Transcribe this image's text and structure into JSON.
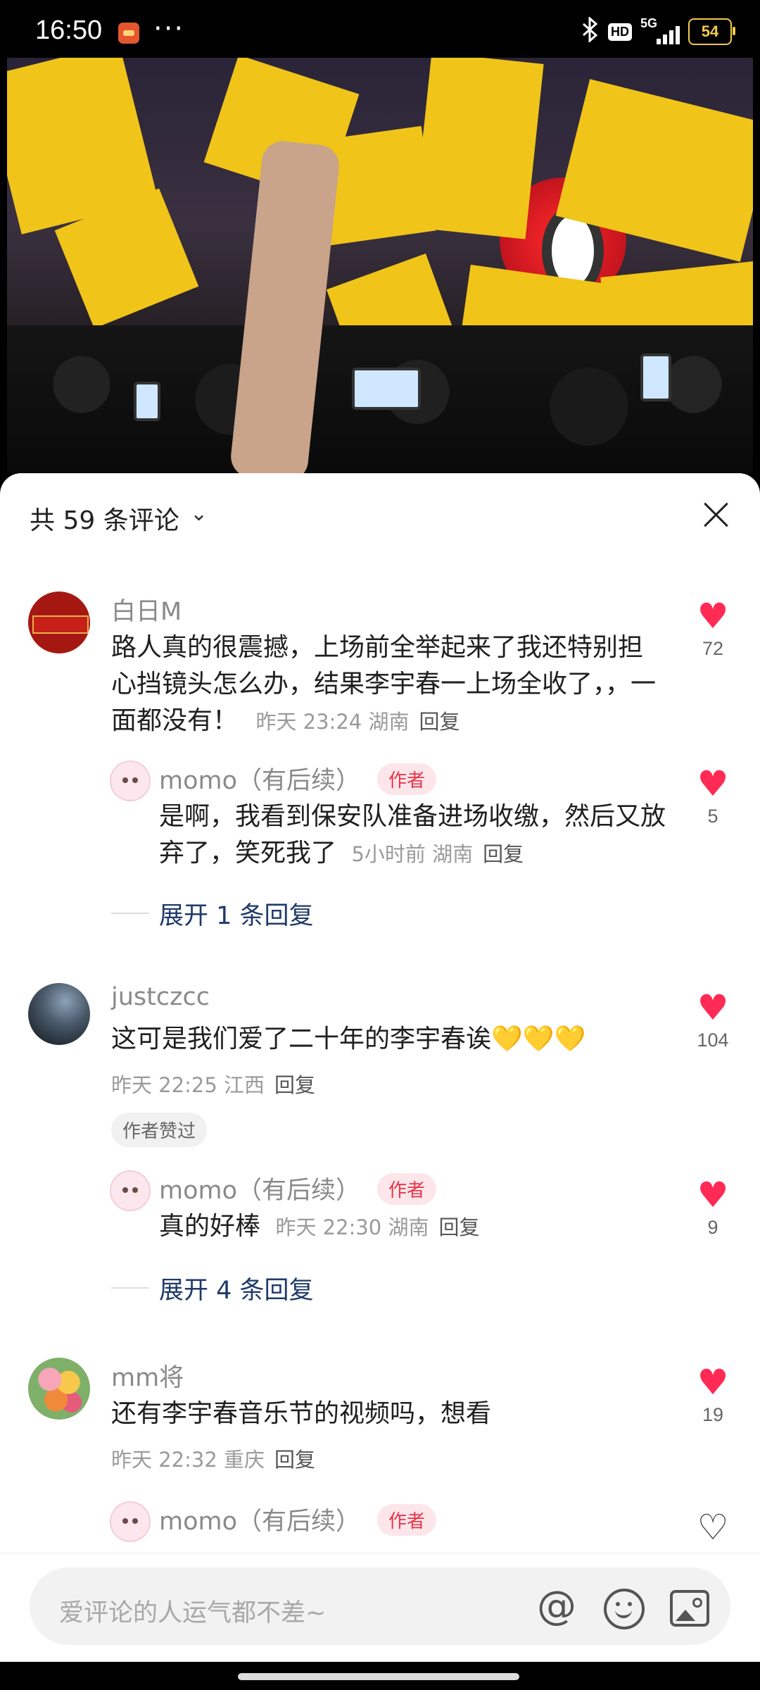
{
  "status_bar": {
    "time": "16:50",
    "dots": "···",
    "hd": "HD",
    "network": "5G",
    "battery": "54"
  },
  "icons": {
    "bluetooth": "bluetooth-icon",
    "close": "close-icon",
    "heart": "heart-icon",
    "at": "at-icon",
    "emoji": "emoji-icon",
    "image": "image-icon"
  },
  "header": {
    "count_label": "共 59 条评论",
    "chevron": "⌄"
  },
  "comments": [
    {
      "user": "白日M",
      "text": "路人真的很震撼，上场前全举起来了我还特别担心挡镜头怎么办，结果李宇春一上场全收了，，一面都没有！",
      "meta": "昨天 23:24 湖南",
      "reply_label": "回复",
      "likes": "72",
      "replies": [
        {
          "user": "momo（有后续）",
          "tag": "作者",
          "text": "是啊，我看到保安队准备进场收缴，然后又放弃了，笑死我了",
          "meta": "5小时前 湖南",
          "reply_label": "回复",
          "likes": "5"
        }
      ],
      "expand": "展开 1 条回复"
    },
    {
      "user": "justczcc",
      "text": "这可是我们爱了二十年的李宇春诶",
      "emoji": "💛💛💛",
      "meta": "昨天 22:25 江西",
      "reply_label": "回复",
      "likes": "104",
      "badge": "作者赞过",
      "replies": [
        {
          "user": "momo（有后续）",
          "tag": "作者",
          "text": "真的好棒",
          "meta": "昨天 22:30 湖南",
          "reply_label": "回复",
          "likes": "9"
        }
      ],
      "expand": "展开 4 条回复"
    },
    {
      "user": "mm将",
      "text": "还有李宇春音乐节的视频吗，想看",
      "meta": "昨天 22:32 重庆",
      "reply_label": "回复",
      "likes": "19",
      "replies": [
        {
          "user": "momo（有后续）",
          "tag": "作者"
        }
      ]
    }
  ],
  "input": {
    "placeholder": "爱评论的人运气都不差~",
    "at_symbol": "@"
  },
  "colors": {
    "like": "#ff2b55",
    "author_tag": "#e8354a",
    "expand": "#1f3a6a",
    "flag": "#f0c419"
  }
}
